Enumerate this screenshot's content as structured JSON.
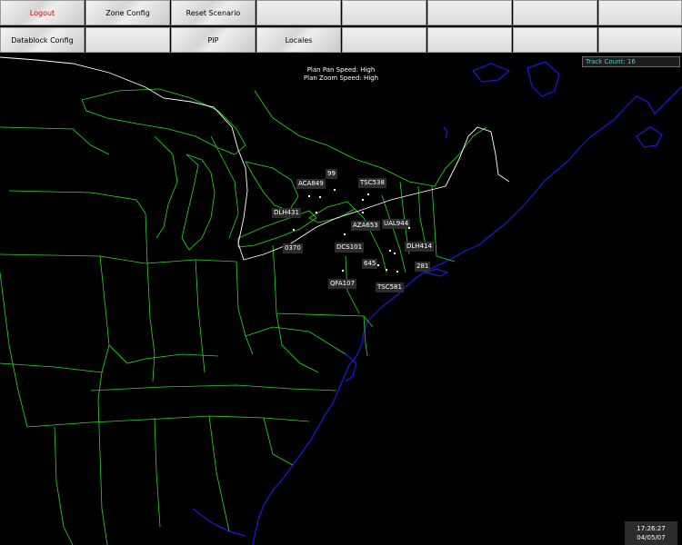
{
  "toolbar": {
    "row1": [
      "Logout",
      "Zone Config",
      "Reset Scenario",
      "",
      "",
      "",
      "",
      ""
    ],
    "row2": [
      "Datablock Config",
      "",
      "PIP",
      "Locales",
      "",
      "",
      "",
      ""
    ]
  },
  "status": {
    "pan_speed": "Plan Pan Speed: High",
    "zoom_speed": "Plan Zoom Speed: High",
    "track_count": "Track Count: 16"
  },
  "tracks": [
    {
      "label": "99"
    },
    {
      "label": "ACA849"
    },
    {
      "label": "TSC538"
    },
    {
      "label": "DLH431"
    },
    {
      "label": "AZA653"
    },
    {
      "label": "UAL944"
    },
    {
      "label": "0370"
    },
    {
      "label": "DCS101"
    },
    {
      "label": "DLH414"
    },
    {
      "label": "645"
    },
    {
      "label": "281"
    },
    {
      "label": "QFA107"
    },
    {
      "label": "TSC581"
    }
  ],
  "clock": {
    "time": "17:26:27",
    "date": "04/05/07"
  },
  "colors": {
    "state_lines": "#22dd22",
    "coast": "#1a1adc",
    "border": "#ffffff",
    "track_count_text": "#2fd8d8"
  }
}
